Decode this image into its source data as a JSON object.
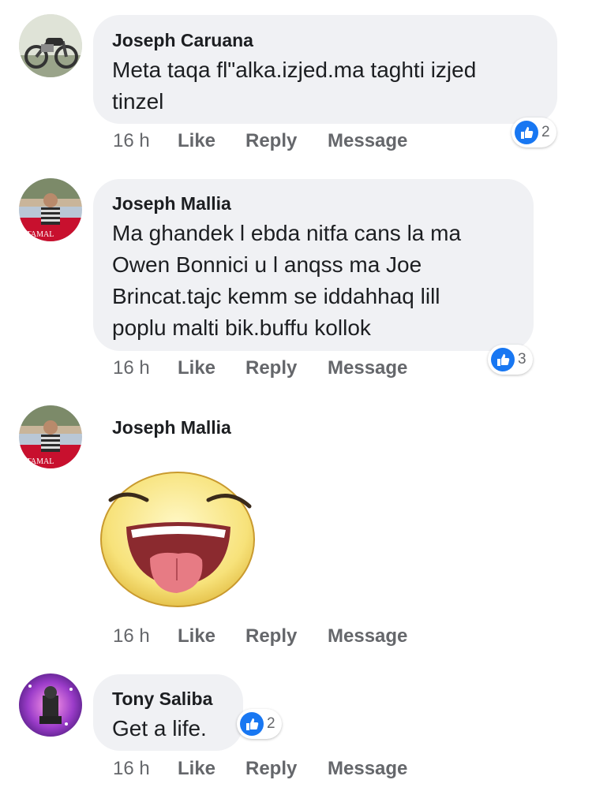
{
  "comments": [
    {
      "author": "Joseph Caruana",
      "text": "Meta taqa fl\"alka.izjed.ma taghti izjed\ntinzel",
      "time": "16 h",
      "like_label": "Like",
      "reply_label": "Reply",
      "message_label": "Message",
      "reaction_count": "2"
    },
    {
      "author": "Joseph Mallia",
      "text": "Ma ghandek l ebda nitfa cans la ma\nOwen Bonnici u l anqss ma Joe\nBrincat.tajc kemm se iddahhaq lill\npoplu malti bik.buffu kollok",
      "time": "16 h",
      "like_label": "Like",
      "reply_label": "Reply",
      "message_label": "Message",
      "reaction_count": "3",
      "avatar_caption": "STAMAL"
    },
    {
      "author": "Joseph Mallia",
      "sticker": "laughing-tongue-emoji",
      "time": "16 h",
      "like_label": "Like",
      "reply_label": "Reply",
      "message_label": "Message",
      "avatar_caption": "STAMAL"
    },
    {
      "author": "Tony Saliba",
      "text": "Get a life.",
      "time": "16 h",
      "like_label": "Like",
      "reply_label": "Reply",
      "message_label": "Message",
      "reaction_count": "2"
    }
  ],
  "colors": {
    "bubble": "#f0f1f4",
    "like_blue": "#1877f2",
    "meta_gray": "#65676b"
  }
}
